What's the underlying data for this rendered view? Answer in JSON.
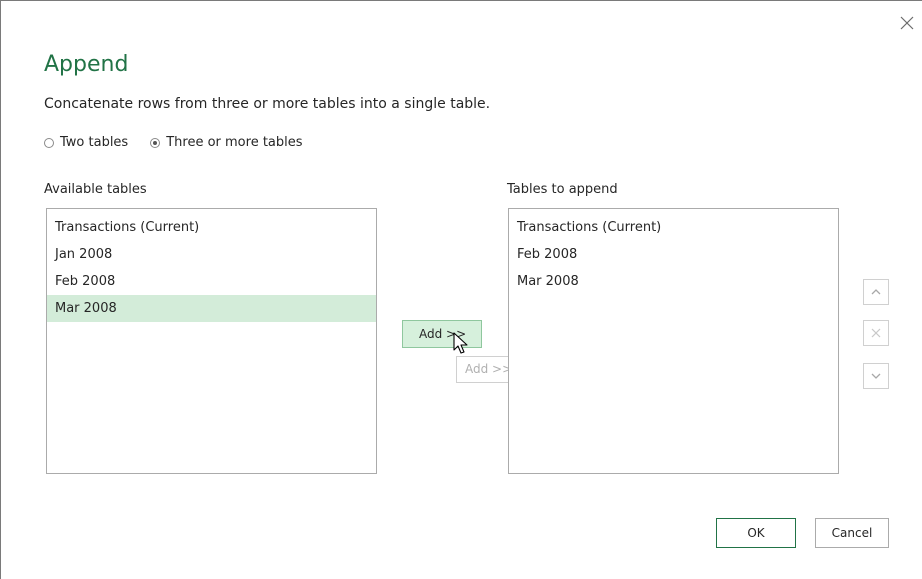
{
  "dialog": {
    "title": "Append",
    "description": "Concatenate rows from three or more tables into a single table.",
    "accent_color": "#217346",
    "selection_color": "#d3ecd9"
  },
  "mode": {
    "options": [
      {
        "label": "Two tables",
        "checked": false
      },
      {
        "label": "Three or more tables",
        "checked": true
      }
    ]
  },
  "available": {
    "label": "Available tables",
    "items": [
      {
        "label": "Transactions (Current)",
        "selected": false
      },
      {
        "label": "Jan 2008",
        "selected": false
      },
      {
        "label": "Feb 2008",
        "selected": false
      },
      {
        "label": "Mar 2008",
        "selected": true
      }
    ]
  },
  "append": {
    "label": "Tables to append",
    "items": [
      {
        "label": "Transactions (Current)"
      },
      {
        "label": "Feb 2008"
      },
      {
        "label": "Mar 2008"
      }
    ]
  },
  "actions": {
    "add_label": "Add >>",
    "drag_ghost_label": "Add >>",
    "move_up_icon": "chevron-up-icon",
    "remove_icon": "close-icon",
    "move_down_icon": "chevron-down-icon"
  },
  "footer": {
    "ok_label": "OK",
    "cancel_label": "Cancel"
  }
}
